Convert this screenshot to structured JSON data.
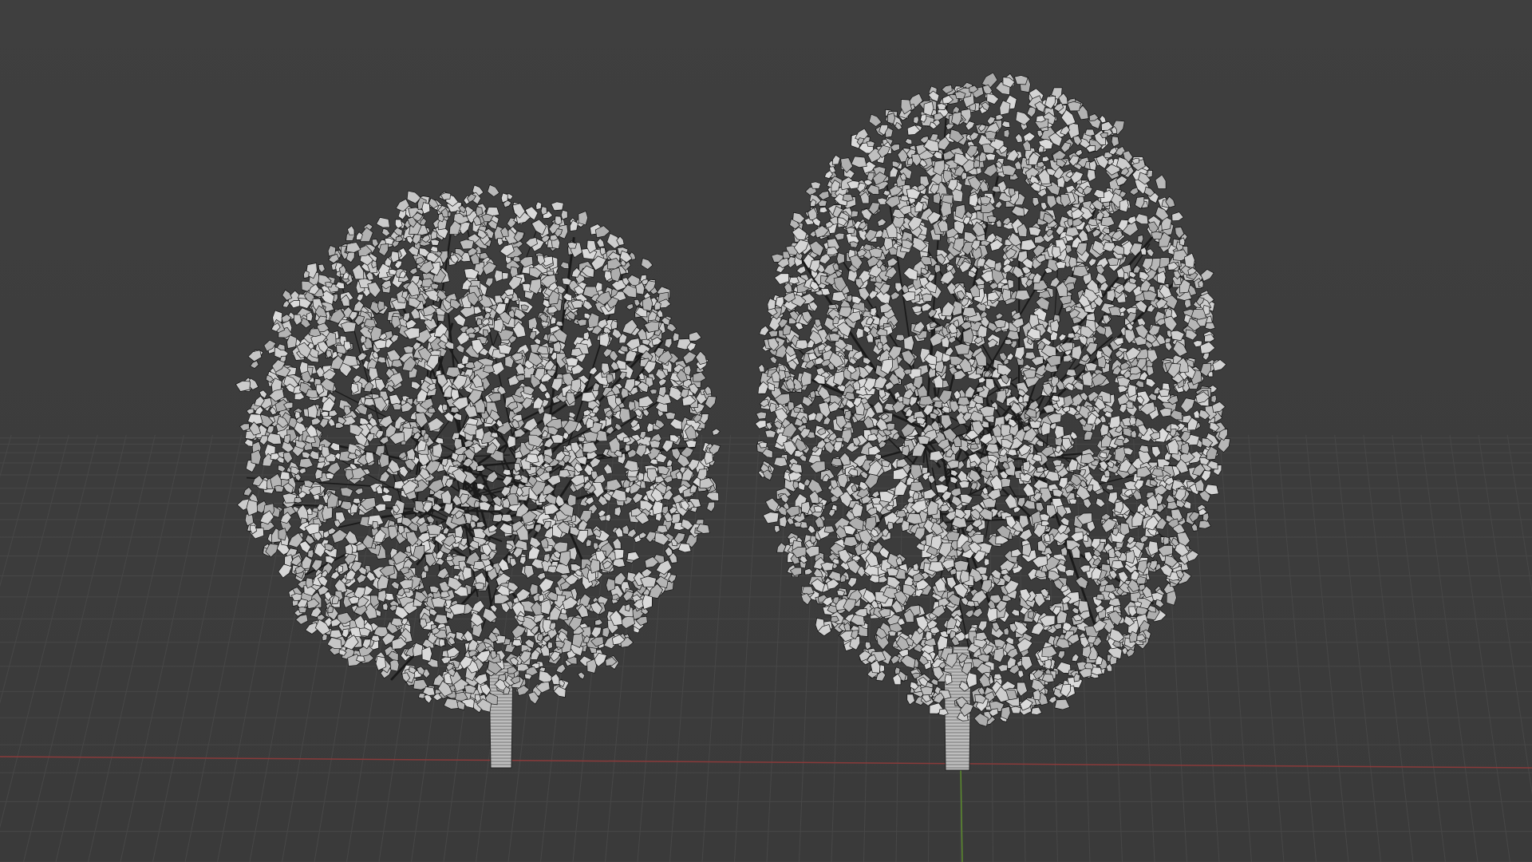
{
  "viewport": {
    "mode": "solid-wireframe",
    "objects": [
      {
        "name": "tree-left"
      },
      {
        "name": "tree-right"
      }
    ]
  },
  "colors": {
    "background": "#3d3d3d",
    "grid": "#474747",
    "x_axis": "#8a3a3a",
    "y_axis": "#5b8a2e",
    "leaf_fill": "#c9c9c9",
    "leaf_edge": "#111111",
    "trunk": "#bdbdbd"
  }
}
